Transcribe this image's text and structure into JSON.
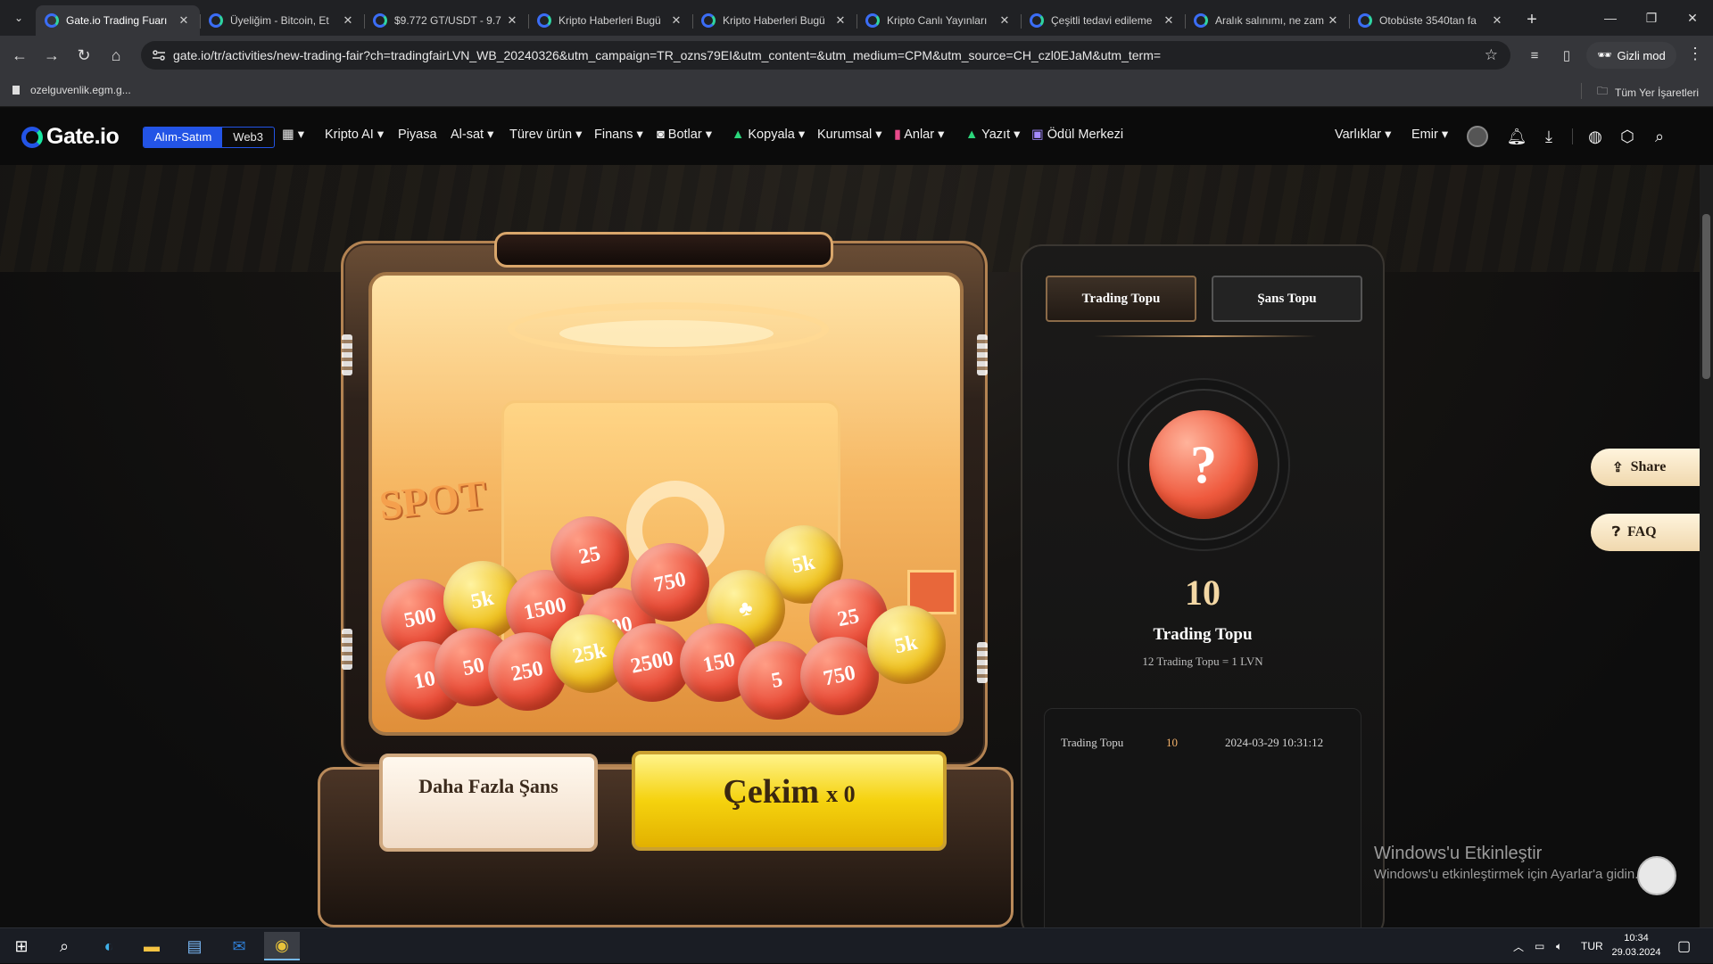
{
  "browser": {
    "tabs": [
      {
        "title": "Gate.io Trading Fuarı",
        "active": true
      },
      {
        "title": "Üyeliğim - Bitcoin, Et"
      },
      {
        "title": "$9.772 GT/USDT - 9.7"
      },
      {
        "title": "Kripto Haberleri Bugü"
      },
      {
        "title": "Kripto Haberleri Bugü"
      },
      {
        "title": "Kripto Canlı Yayınları"
      },
      {
        "title": "Çeşitli tedavi edileme"
      },
      {
        "title": "Aralık salınımı, ne zam"
      },
      {
        "title": "Otobüste 3540tan fa"
      }
    ],
    "url": "gate.io/tr/activities/new-trading-fair?ch=tradingfairLVN_WB_20240326&utm_campaign=TR_ozns79EI&utm_content=&utm_medium=CPM&utm_source=CH_czl0EJaM&utm_term=",
    "incognito_label": "Gizli mod",
    "bookmark": "ozelguvenlik.egm.g...",
    "all_bookmarks": "Tüm Yer İşaretleri"
  },
  "site": {
    "logo": "Gate.io",
    "seg_left": "Alım-Satım",
    "seg_right": "Web3",
    "menu": [
      "Kripto AI",
      "Piyasa",
      "Al-sat",
      "Türev ürün",
      "Finans",
      "Botlar",
      "Kopyala",
      "Kurumsal",
      "Anlar",
      "Yazıt",
      "Ödül Merkezi"
    ],
    "right_menu": [
      "Varlıklar",
      "Emir"
    ]
  },
  "machine": {
    "balls": [
      "500",
      "5k",
      "1500",
      "25",
      "500",
      "750",
      "5k",
      "25",
      "10",
      "50",
      "250",
      "25k",
      "2500",
      "150",
      "5",
      "750",
      "5k"
    ],
    "spot_text": "SPOT",
    "more_chance_label": "Daha Fazla Şans",
    "draw_label": "Çekim",
    "draw_count": "x 0"
  },
  "panel": {
    "tab_active": "Trading Topu",
    "tab_other": "Şans Topu",
    "ball_symbol": "?",
    "count": "10",
    "count_label": "Trading Topu",
    "rate": "12 Trading Topu = 1 LVN",
    "history": [
      {
        "type": "Trading Topu",
        "amount": "10",
        "time": "2024-03-29 10:31:12"
      }
    ]
  },
  "floating": {
    "share": "Share",
    "faq": "FAQ"
  },
  "watermark": {
    "line1": "Windows'u Etkinleştir",
    "line2": "Windows'u etkinleştirmek için Ayarlar'a gidin."
  },
  "taskbar": {
    "lang": "TUR",
    "time": "10:34",
    "date": "29.03.2024"
  },
  "colors": {
    "brand_blue": "#2354e6",
    "accent_gold": "#f5d20e",
    "ball_red": "#ea4f3a"
  }
}
